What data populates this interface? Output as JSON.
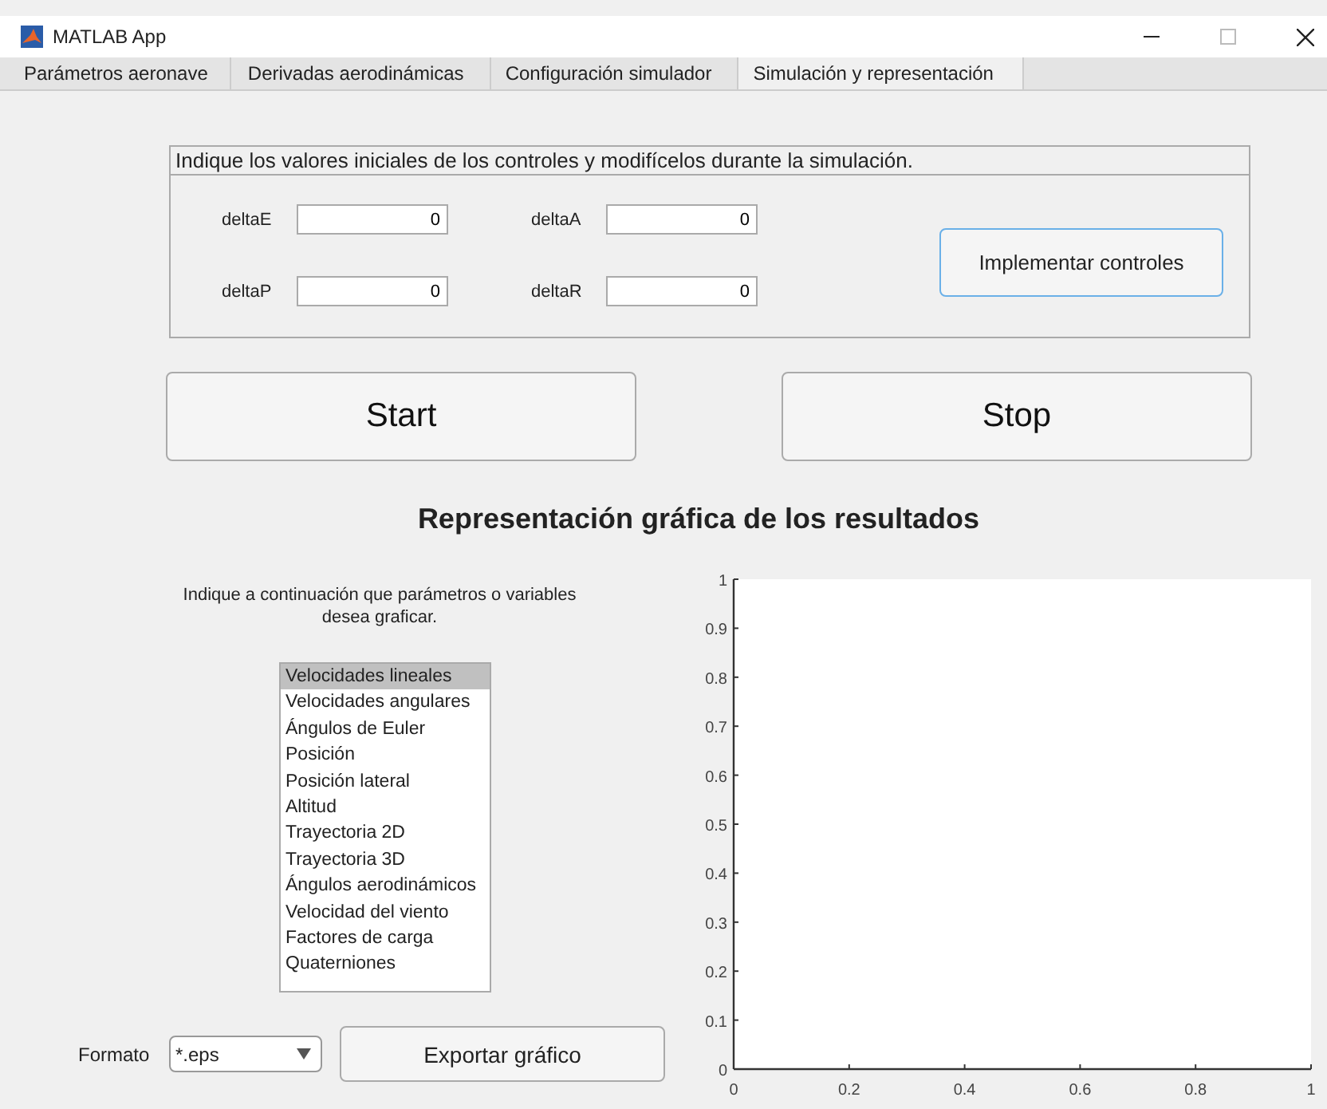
{
  "window": {
    "title": "MATLAB App"
  },
  "tabs": [
    {
      "label": "Parámetros aeronave",
      "selected": false
    },
    {
      "label": "Derivadas aerodinámicas",
      "selected": false
    },
    {
      "label": "Configuración simulador",
      "selected": false
    },
    {
      "label": "Simulación y representación",
      "selected": true
    }
  ],
  "controls_panel": {
    "title": "Indique los valores iniciales de los controles y modifícelos durante la simulación.",
    "fields": [
      {
        "label": "deltaE",
        "value": "0"
      },
      {
        "label": "deltaA",
        "value": "0"
      },
      {
        "label": "deltaP",
        "value": "0"
      },
      {
        "label": "deltaR",
        "value": "0"
      }
    ],
    "button": "Implementar controles"
  },
  "start_button": "Start",
  "stop_button": "Stop",
  "results_title": "Representación gráfica de los resultados",
  "instructions": "Indique a continuación que parámetros o variables desea graficar.",
  "variables": [
    {
      "label": "Velocidades lineales",
      "selected": true
    },
    {
      "label": "Velocidades angulares",
      "selected": false
    },
    {
      "label": "Ángulos de Euler",
      "selected": false
    },
    {
      "label": "Posición",
      "selected": false
    },
    {
      "label": "Posición lateral",
      "selected": false
    },
    {
      "label": "Altitud",
      "selected": false
    },
    {
      "label": "Trayectoria 2D",
      "selected": false
    },
    {
      "label": "Trayectoria 3D",
      "selected": false
    },
    {
      "label": "Ángulos aerodinámicos",
      "selected": false
    },
    {
      "label": "Velocidad del viento",
      "selected": false
    },
    {
      "label": "Factores de carga",
      "selected": false
    },
    {
      "label": "Quaterniones",
      "selected": false
    }
  ],
  "format": {
    "label": "Formato",
    "value": "*.eps"
  },
  "export_button": "Exportar gráfico",
  "plot": {
    "chart_data": {
      "type": "line",
      "xlim": [
        0,
        1
      ],
      "ylim": [
        0,
        1
      ],
      "xticks": [
        0,
        0.2,
        0.4,
        0.6,
        0.8,
        1
      ],
      "yticks": [
        0,
        0.1,
        0.2,
        0.3,
        0.4,
        0.5,
        0.6,
        0.7,
        0.8,
        0.9,
        1
      ]
    }
  }
}
